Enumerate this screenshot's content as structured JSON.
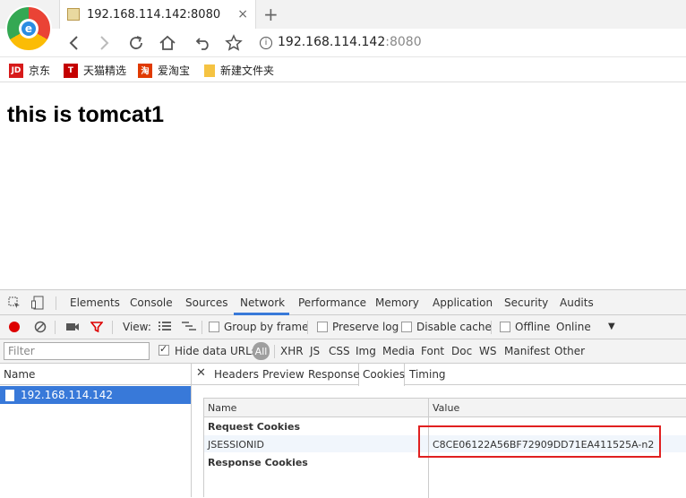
{
  "browser": {
    "tab_title": "192.168.114.142:8080",
    "tab_close": "×",
    "new_tab": "+",
    "url_host": "192.168.114.142",
    "url_port": ":8080",
    "logo_letter": "e"
  },
  "bookmarks": [
    {
      "label": "京东",
      "icon_text": "JD",
      "color": "#d71a1a"
    },
    {
      "label": "天猫精选",
      "icon_text": "T",
      "color": "#c40000"
    },
    {
      "label": "爱淘宝",
      "icon_text": "淘",
      "color": "#e03a00"
    },
    {
      "label": "新建文件夹",
      "icon_text": "",
      "color": "#f5c342"
    }
  ],
  "page": {
    "heading": "this is tomcat1"
  },
  "devtools": {
    "tabs": [
      "Elements",
      "Console",
      "Sources",
      "Network",
      "Performance",
      "Memory",
      "Application",
      "Security",
      "Audits"
    ],
    "active_tab": "Network",
    "toolbar": {
      "view_label": "View:",
      "group_by_frame": "Group by frame",
      "preserve_log": "Preserve log",
      "disable_cache": "Disable cache",
      "offline": "Offline",
      "throttle": "Online"
    },
    "filter": {
      "placeholder": "Filter",
      "hide_data_urls": "Hide data URLs",
      "types": [
        "All",
        "XHR",
        "JS",
        "CSS",
        "Img",
        "Media",
        "Font",
        "Doc",
        "WS",
        "Manifest",
        "Other"
      ]
    },
    "requests_header": "Name",
    "requests": [
      "192.168.114.142"
    ],
    "detail_tabs": [
      "Headers",
      "Preview",
      "Response",
      "Cookies",
      "Timing"
    ],
    "active_detail_tab": "Cookies",
    "cookie_table": {
      "col_name": "Name",
      "col_value": "Value",
      "request_section": "Request Cookies",
      "cookie_name": "JSESSIONID",
      "cookie_value": "C8CE06122A56BF72909DD71EA411525A-n2",
      "response_section": "Response Cookies"
    }
  },
  "colors": {
    "accent": "#3879d9",
    "highlight": "#e02020",
    "record": "#dd0000"
  }
}
